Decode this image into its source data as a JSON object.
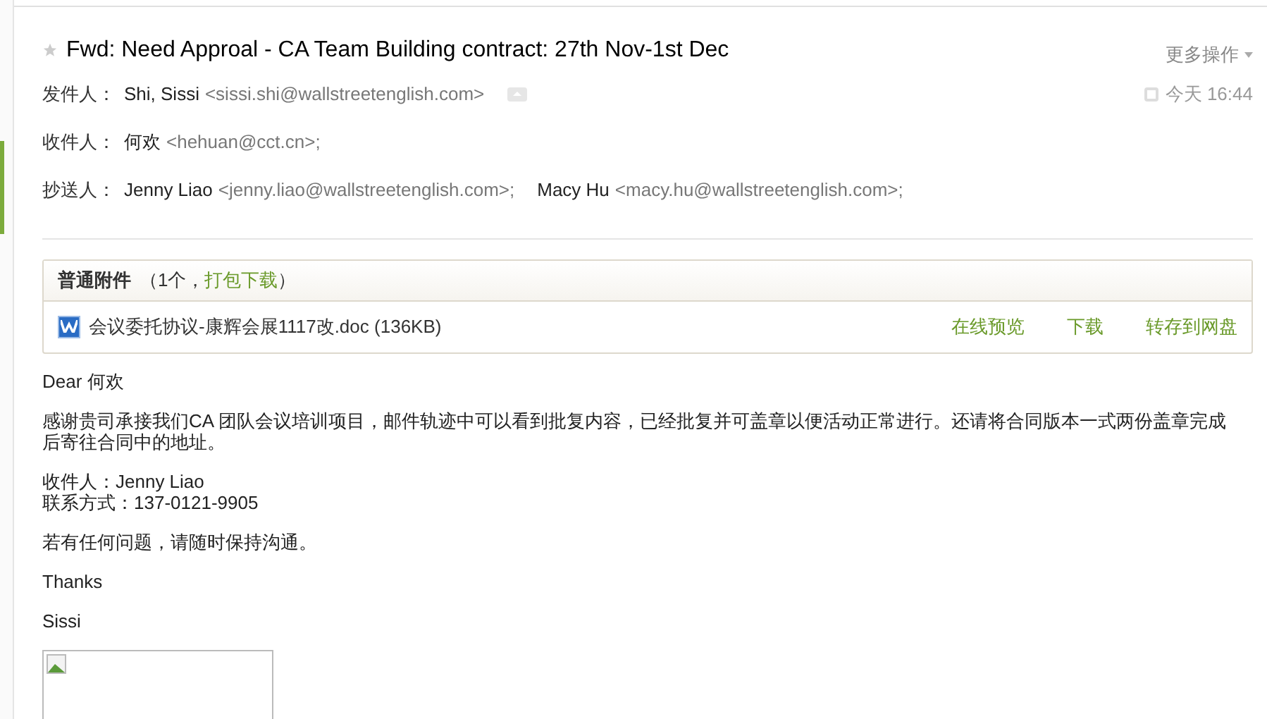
{
  "subject": {
    "starred": false,
    "text": "Fwd: Need Approal - CA Team Building contract: 27th Nov-1st Dec"
  },
  "more_actions": "更多操作",
  "time": "今天 16:44",
  "headers": [
    {
      "label": "发件人：",
      "recipients": [
        {
          "name": "Shi, Sissi",
          "address": "<sissi.shi@wallstreetenglish.com>"
        }
      ]
    },
    {
      "label": "收件人：",
      "recipients": [
        {
          "name": "何欢",
          "address": "<hehuan@cct.cn>;"
        }
      ]
    },
    {
      "label": "抄送人：",
      "recipients": [
        {
          "name": "Jenny Liao",
          "address": "<jenny.liao@wallstreetenglish.com>;"
        },
        {
          "name": "Macy Hu",
          "address": "<macy.hu@wallstreetenglish.com>;"
        }
      ]
    }
  ],
  "attachments": {
    "title": "普通附件",
    "count": "（1个，",
    "download_all": "打包下载",
    "close": "）",
    "files": [
      {
        "name": "会议委托协议-康辉会展1117改.doc",
        "size": "(136KB)",
        "actions": [
          "在线预览",
          "下载",
          "转存到网盘"
        ]
      }
    ]
  },
  "body": [
    {
      "lines": [
        "Dear 何欢"
      ]
    },
    {
      "lines": [
        "感谢贵司承接我们CA 团队会议培训项目，邮件轨迹中可以看到批复内容，已经批复并可盖章以便活动正常进行。还请将合同版本一式两份盖章完成后寄往合同中的地址。"
      ]
    },
    {
      "lines": [
        "收件人：Jenny Liao",
        "联系方式：137-0121-9905"
      ]
    },
    {
      "lines": [
        "若有任何问题，请随时保持沟通。"
      ]
    },
    {
      "lines": [
        "Thanks"
      ]
    },
    {
      "lines": [
        "Sissi"
      ]
    }
  ]
}
